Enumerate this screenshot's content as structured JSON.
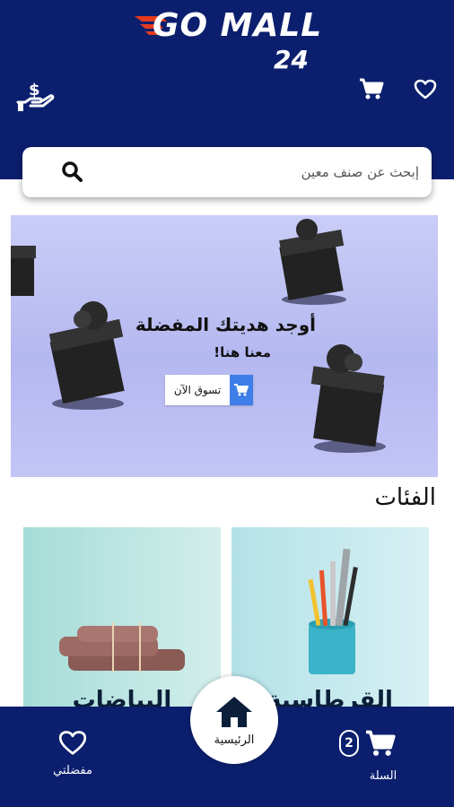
{
  "header": {
    "logo_main": "GO MALL",
    "logo_sub": "24",
    "icons": [
      "money-hand-icon",
      "cart-icon",
      "heart-icon"
    ],
    "bg_color": "#0b1f6e",
    "accent_color": "#e63b1f"
  },
  "search": {
    "placeholder": "إبحث عن صنف معين",
    "icon": "search-icon"
  },
  "banner": {
    "title": "أوجد هديتك المفضلة",
    "subtitle": "معنا هنا!",
    "button_label": "تسوق الآن"
  },
  "categories": {
    "title": "الفئات",
    "items": [
      {
        "label": "البياضات",
        "icon": "towels-image"
      },
      {
        "label": "القرطاسية",
        "icon": "stationery-image"
      }
    ]
  },
  "bottom_nav": {
    "favorites_label": "مفضلتي",
    "home_label": "الرئيسية",
    "cart_label": "السلة",
    "cart_count": "2"
  }
}
